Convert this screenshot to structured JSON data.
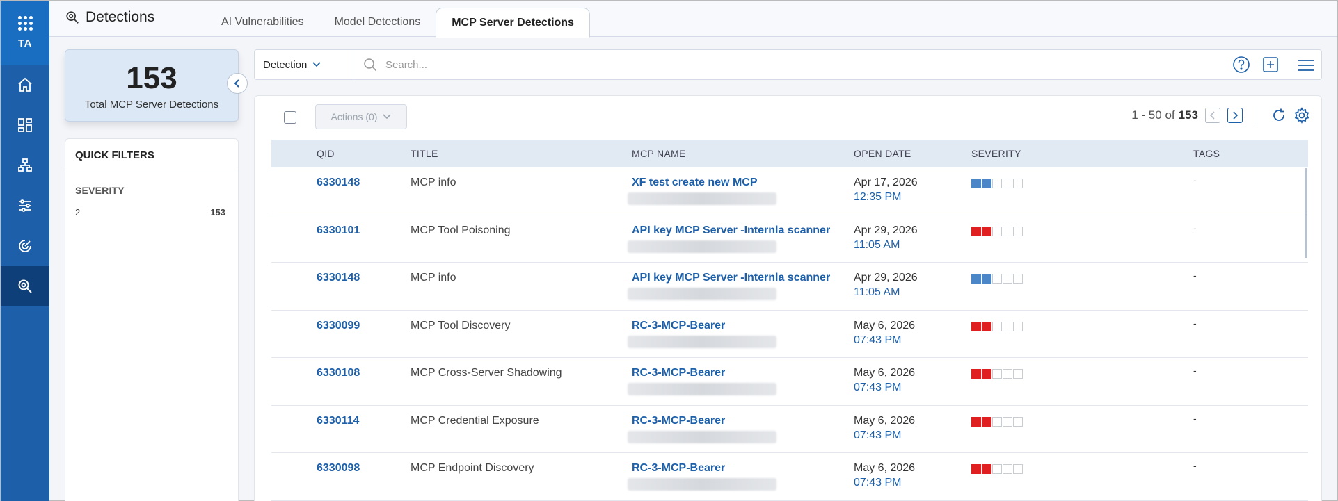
{
  "nav": {
    "initials": "TA"
  },
  "header": {
    "title": "Detections",
    "tabs": [
      {
        "label": "AI Vulnerabilities",
        "active": false
      },
      {
        "label": "Model Detections",
        "active": false
      },
      {
        "label": "MCP Server Detections",
        "active": true
      }
    ]
  },
  "summary": {
    "count": "153",
    "label": "Total MCP Server Detections"
  },
  "quick_filters": {
    "title": "QUICK FILTERS",
    "section": "SEVERITY",
    "items": [
      {
        "label": "2",
        "count": "153"
      }
    ]
  },
  "search": {
    "type": "Detection",
    "placeholder": "Search..."
  },
  "toolbar": {
    "actions_label": "Actions (0)",
    "range": "1 - 50 of",
    "total": "153"
  },
  "table": {
    "columns": [
      "QID",
      "TITLE",
      "MCP NAME",
      "OPEN DATE",
      "SEVERITY",
      "TAGS"
    ],
    "rows": [
      {
        "qid": "6330148",
        "title": "MCP info",
        "mcp": "XF test create new MCP",
        "date": "Apr 17, 2026",
        "time": "12:35 PM",
        "sev_color": "#4a86c8",
        "tags": "-"
      },
      {
        "qid": "6330101",
        "title": "MCP Tool Poisoning",
        "mcp": "API key MCP Server -Internla scanner",
        "date": "Apr 29, 2026",
        "time": "11:05 AM",
        "sev_color": "#e02020",
        "tags": "-"
      },
      {
        "qid": "6330148",
        "title": "MCP info",
        "mcp": "API key MCP Server -Internla scanner",
        "date": "Apr 29, 2026",
        "time": "11:05 AM",
        "sev_color": "#4a86c8",
        "tags": "-"
      },
      {
        "qid": "6330099",
        "title": "MCP Tool Discovery",
        "mcp": "RC-3-MCP-Bearer",
        "date": "May 6, 2026",
        "time": "07:43 PM",
        "sev_color": "#e02020",
        "tags": "-"
      },
      {
        "qid": "6330108",
        "title": "MCP Cross-Server Shadowing",
        "mcp": "RC-3-MCP-Bearer",
        "date": "May 6, 2026",
        "time": "07:43 PM",
        "sev_color": "#e02020",
        "tags": "-"
      },
      {
        "qid": "6330114",
        "title": "MCP Credential Exposure",
        "mcp": "RC-3-MCP-Bearer",
        "date": "May 6, 2026",
        "time": "07:43 PM",
        "sev_color": "#e02020",
        "tags": "-"
      },
      {
        "qid": "6330098",
        "title": "MCP Endpoint Discovery",
        "mcp": "RC-3-MCP-Bearer",
        "date": "May 6, 2026",
        "time": "07:43 PM",
        "sev_color": "#e02020",
        "tags": "-"
      }
    ]
  },
  "colors": {
    "primary": "#1d5fa8",
    "nav_bg": "#1d5fa8",
    "nav_active": "#0f3f78",
    "sev_red": "#e02020",
    "sev_blue": "#4a86c8"
  }
}
